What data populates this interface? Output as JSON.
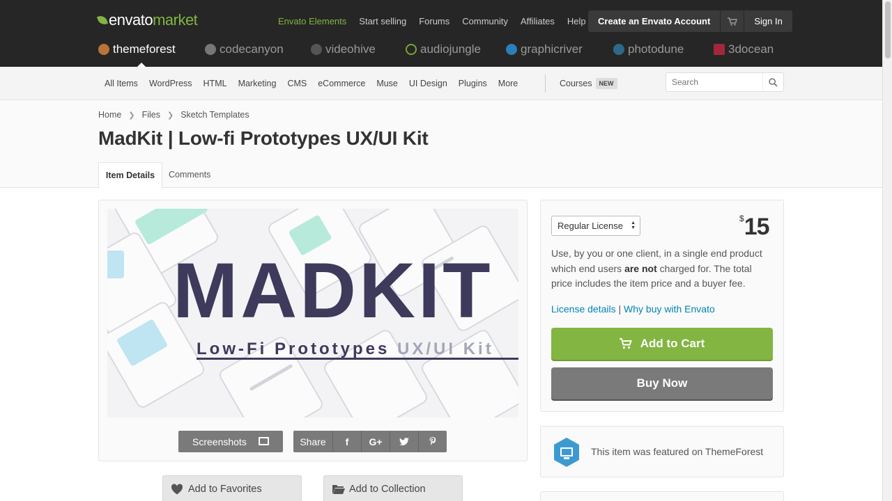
{
  "brand": {
    "envato": "envato",
    "market": "market",
    "accent": "#82b541"
  },
  "topnav": [
    "Envato Elements",
    "Start selling",
    "Forums",
    "Community",
    "Affiliates",
    "Help"
  ],
  "account": {
    "create": "Create an Envato Account",
    "signin": "Sign In"
  },
  "sites": [
    {
      "name": "themeforest",
      "color": "#b8743a",
      "active": true
    },
    {
      "name": "codecanyon",
      "color": "#8a8a8a",
      "active": false
    },
    {
      "name": "videohive",
      "color": "#6e6e6e",
      "active": false
    },
    {
      "name": "audiojungle",
      "color": "#7aa33c",
      "active": false
    },
    {
      "name": "graphicriver",
      "color": "#2b7fb8",
      "active": false
    },
    {
      "name": "photodune",
      "color": "#2d6a8a",
      "active": false
    },
    {
      "name": "3docean",
      "color": "#a1283c",
      "active": false
    }
  ],
  "categories": [
    "All Items",
    "WordPress",
    "HTML",
    "Marketing",
    "CMS",
    "eCommerce",
    "Muse",
    "UI Design",
    "Plugins",
    "More"
  ],
  "courses": {
    "label": "Courses",
    "badge": "NEW"
  },
  "search": {
    "placeholder": "Search"
  },
  "breadcrumb": [
    "Home",
    "Files",
    "Sketch Templates"
  ],
  "page_title": "MadKit | Low-fi Prototypes UX/UI Kit",
  "tabs": [
    "Item Details",
    "Comments"
  ],
  "hero": {
    "title": "MADKIT",
    "sub_dark": "Low-Fi Prototypes",
    "sub_light": "UX/UI Kit"
  },
  "preview_buttons": {
    "screenshots": "Screenshots",
    "share": "Share"
  },
  "actions": {
    "favorites": "Add to Favorites",
    "collection": "Add to Collection"
  },
  "purchase": {
    "license": "Regular License",
    "currency": "$",
    "price": "15",
    "desc_1": "Use, by you or one client, in a single end product which end users ",
    "desc_bold": "are not",
    "desc_2": " charged for. The total price includes the item price and a buyer fee.",
    "link_license": "License details",
    "link_sep": " | ",
    "link_why": "Why buy with Envato",
    "add_to_cart": "Add to Cart",
    "buy_now": "Buy Now"
  },
  "featured": "This item was featured on ThemeForest"
}
